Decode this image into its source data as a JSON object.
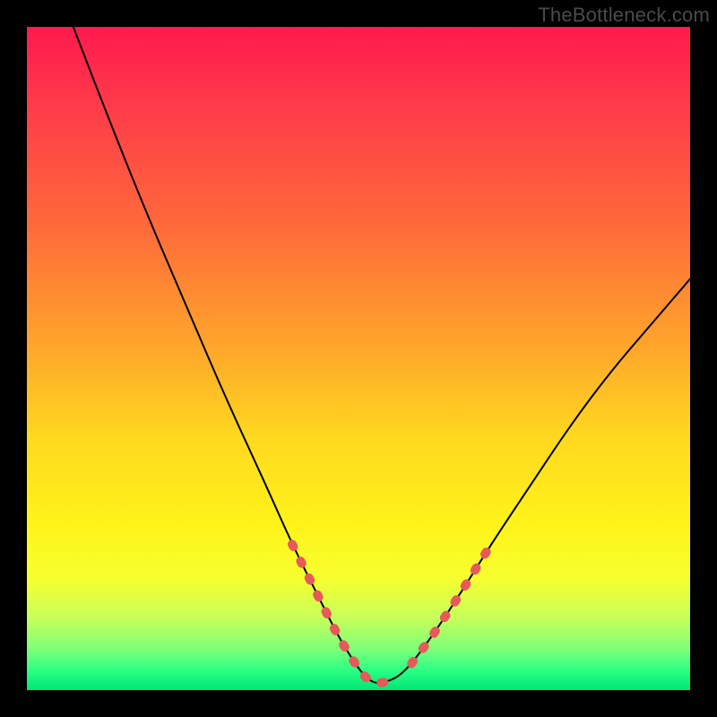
{
  "watermark": "TheBottleneck.com",
  "chart_data": {
    "type": "line",
    "title": "",
    "xlabel": "",
    "ylabel": "",
    "xlim": [
      0,
      100
    ],
    "ylim": [
      0,
      100
    ],
    "grid": false,
    "legend": false,
    "series": [
      {
        "name": "curve",
        "color": "#000000",
        "x": [
          7,
          12,
          18,
          24,
          30,
          36,
          40,
          44,
          47,
          49.5,
          51,
          52.5,
          54,
          56,
          58,
          61,
          65,
          70,
          76,
          82,
          88,
          94,
          100
        ],
        "y": [
          100,
          87,
          72,
          58,
          44,
          31,
          22,
          14,
          8,
          4,
          2,
          1,
          1.2,
          2,
          4,
          8,
          14,
          22,
          31,
          40,
          48,
          55,
          62
        ]
      }
    ],
    "highlight_segments": {
      "comment": "salmon thick dotted portions of the curve near the valley",
      "color": "#e65a5a",
      "ranges_x": [
        [
          40,
          54
        ],
        [
          58,
          70
        ]
      ]
    }
  }
}
